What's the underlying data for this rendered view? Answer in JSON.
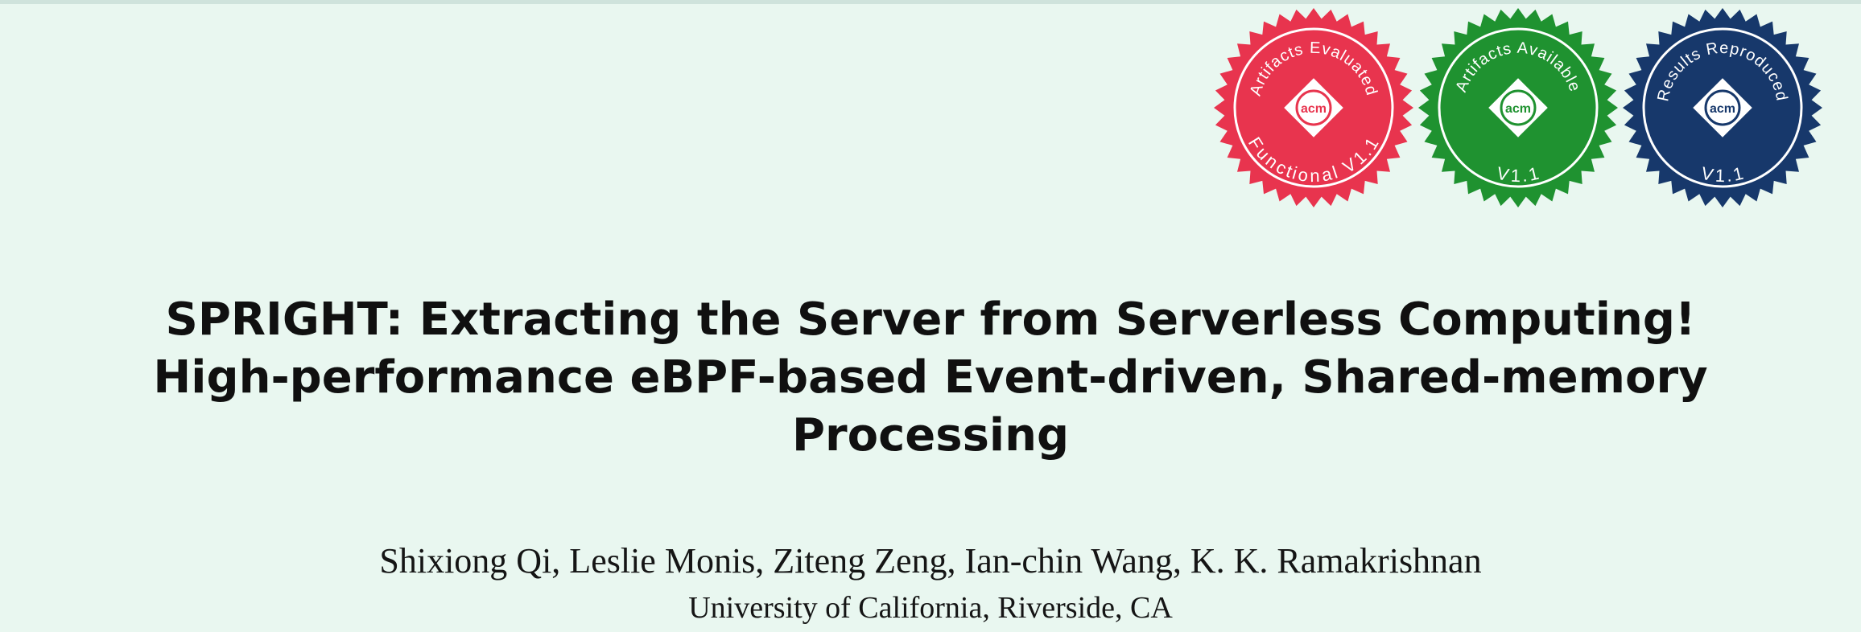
{
  "badges": [
    {
      "top_text": "Artifacts Evaluated",
      "bottom_text": "Functional V1.1",
      "logo_text": "acm",
      "color": "#e8344e"
    },
    {
      "top_text": "Artifacts Available",
      "bottom_text": "V1.1",
      "logo_text": "acm",
      "color": "#1f9230"
    },
    {
      "top_text": "Results Reproduced",
      "bottom_text": "V1.1",
      "logo_text": "acm",
      "color": "#17386b"
    }
  ],
  "paper": {
    "title_lines": [
      "SPRIGHT: Extracting the Server from Serverless Computing!",
      "High-performance eBPF-based Event-driven, Shared-memory",
      "Processing"
    ],
    "authors": "Shixiong Qi, Leslie Monis, Ziteng Zeng, Ian-chin Wang, K. K. Ramakrishnan",
    "affiliation": "University of California, Riverside, CA"
  }
}
